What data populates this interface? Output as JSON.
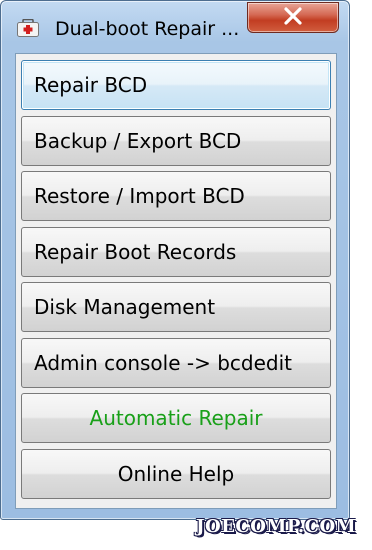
{
  "window": {
    "title": "Dual-boot Repair ...",
    "app_icon": "first-aid-kit-icon",
    "close_icon": "close-icon"
  },
  "buttons": [
    {
      "label": "Repair BCD"
    },
    {
      "label": "Backup / Export BCD"
    },
    {
      "label": "Restore / Import BCD"
    },
    {
      "label": "Repair Boot Records"
    },
    {
      "label": "Disk Management"
    },
    {
      "label": "Admin console -> bcdedit"
    },
    {
      "label": "Automatic Repair"
    },
    {
      "label": "Online Help"
    }
  ],
  "colors": {
    "automatic_repair_text": "#19a019",
    "close_button": "#c23d22"
  },
  "watermark": {
    "text": "JOECOMP.COM"
  }
}
